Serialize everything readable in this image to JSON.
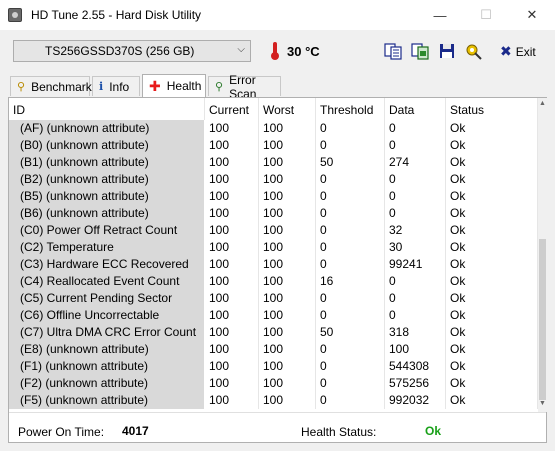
{
  "window": {
    "title": "HD Tune 2.55 - Hard Disk Utility",
    "minimize": "—",
    "maximize": "☐",
    "close": "✕"
  },
  "toolbar": {
    "drive": "TS256GSSD370S (256 GB)",
    "temperature": "30 °C",
    "exit_label": "Exit",
    "icons": [
      "copy-text-icon",
      "copy-screenshot-icon",
      "save-icon",
      "options-icon",
      "exit-icon"
    ]
  },
  "tabs": [
    {
      "label": "Benchmark",
      "icon": "benchmark-icon"
    },
    {
      "label": "Info",
      "icon": "info-icon"
    },
    {
      "label": "Health",
      "icon": "health-icon",
      "active": true
    },
    {
      "label": "Error Scan",
      "icon": "error-scan-icon"
    }
  ],
  "table": {
    "columns": [
      "ID",
      "Current",
      "Worst",
      "Threshold",
      "Data",
      "Status"
    ],
    "rows": [
      [
        "(AF) (unknown attribute)",
        "100",
        "100",
        "0",
        "0",
        "Ok"
      ],
      [
        "(B0) (unknown attribute)",
        "100",
        "100",
        "0",
        "0",
        "Ok"
      ],
      [
        "(B1) (unknown attribute)",
        "100",
        "100",
        "50",
        "274",
        "Ok"
      ],
      [
        "(B2) (unknown attribute)",
        "100",
        "100",
        "0",
        "0",
        "Ok"
      ],
      [
        "(B5) (unknown attribute)",
        "100",
        "100",
        "0",
        "0",
        "Ok"
      ],
      [
        "(B6) (unknown attribute)",
        "100",
        "100",
        "0",
        "0",
        "Ok"
      ],
      [
        "(C0) Power Off Retract Count",
        "100",
        "100",
        "0",
        "32",
        "Ok"
      ],
      [
        "(C2) Temperature",
        "100",
        "100",
        "0",
        "30",
        "Ok"
      ],
      [
        "(C3) Hardware ECC Recovered",
        "100",
        "100",
        "0",
        "99241",
        "Ok"
      ],
      [
        "(C4) Reallocated Event Count",
        "100",
        "100",
        "16",
        "0",
        "Ok"
      ],
      [
        "(C5) Current Pending Sector",
        "100",
        "100",
        "0",
        "0",
        "Ok"
      ],
      [
        "(C6) Offline Uncorrectable",
        "100",
        "100",
        "0",
        "0",
        "Ok"
      ],
      [
        "(C7) Ultra DMA CRC Error Count",
        "100",
        "100",
        "50",
        "318",
        "Ok"
      ],
      [
        "(E8) (unknown attribute)",
        "100",
        "100",
        "0",
        "100",
        "Ok"
      ],
      [
        "(F1) (unknown attribute)",
        "100",
        "100",
        "0",
        "544308",
        "Ok"
      ],
      [
        "(F2) (unknown attribute)",
        "100",
        "100",
        "0",
        "575256",
        "Ok"
      ],
      [
        "(F5) (unknown attribute)",
        "100",
        "100",
        "0",
        "992032",
        "Ok"
      ]
    ]
  },
  "footer": {
    "power_on_label": "Power On Time:",
    "power_on_value": "4017",
    "health_label": "Health Status:",
    "health_value": "Ok"
  },
  "colors": {
    "health_ok": "#18a018",
    "thermometer": "#d32020",
    "id_column_bg": "#d9d9d9"
  }
}
